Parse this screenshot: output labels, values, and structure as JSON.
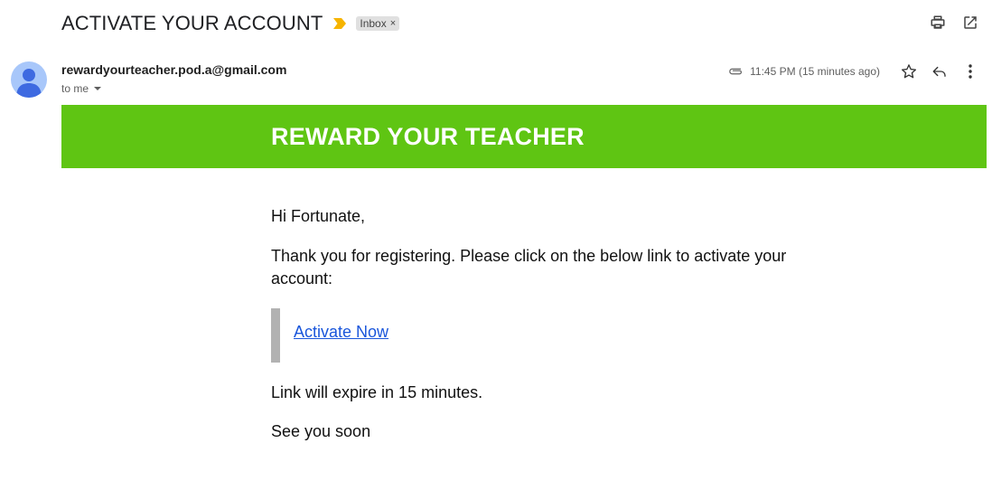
{
  "email": {
    "subject": "ACTIVATE YOUR ACCOUNT",
    "label": "Inbox",
    "label_close": "×",
    "sender": "rewardyourteacher.pod.a@gmail.com",
    "recipient": "to me",
    "time": "11:45 PM (15 minutes ago)"
  },
  "icons": {
    "importance": "importance-marker-icon",
    "print": "print-icon",
    "open_new_window": "open-in-new-window-icon",
    "attachment": "paperclip-icon",
    "star": "star-icon",
    "reply": "reply-icon",
    "more": "more-vertical-icon",
    "avatar": "person-avatar-icon"
  },
  "colors": {
    "banner": "#5fc513",
    "importance": "#f6b400",
    "link": "#1a56db",
    "quote_bar": "#b2b2b2",
    "avatar_bg": "#a8c7fa",
    "avatar_fg": "#3e6ae1"
  },
  "message": {
    "banner_title": "REWARD YOUR TEACHER",
    "greeting": "Hi Fortunate,",
    "intro": "Thank you for registering. Please click on the below link to activate your account:",
    "link_text": "Activate Now",
    "expiry_note": "Link will expire in 15 minutes.",
    "sign_off": "See you soon"
  }
}
